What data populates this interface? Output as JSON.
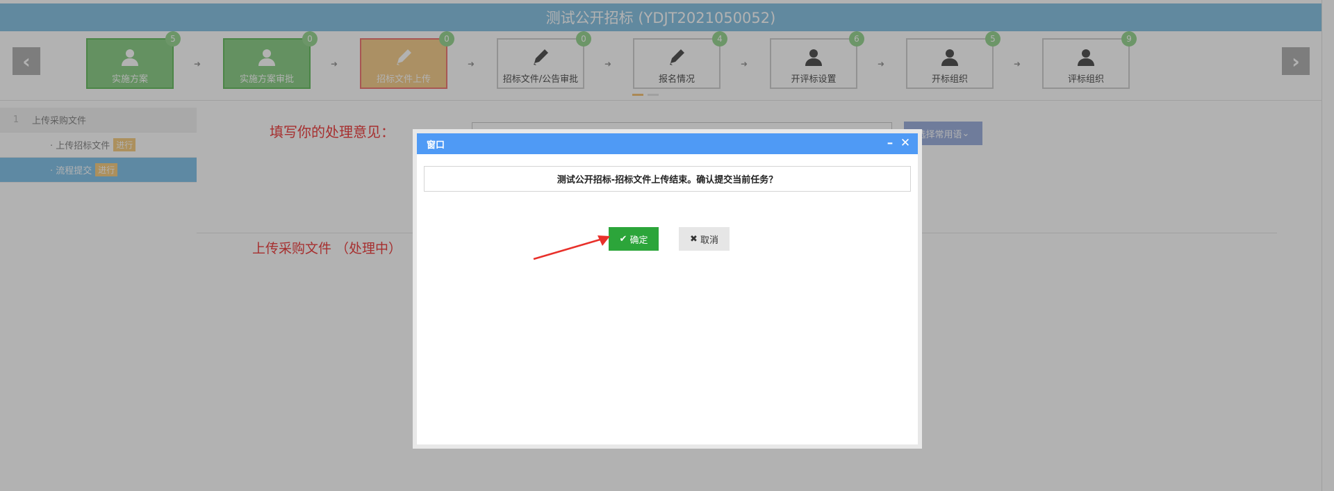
{
  "page": {
    "title": "测试公开招标 (YDJT2021050052)"
  },
  "steps": [
    {
      "label": "实施方案",
      "count": "5",
      "icon": "user-icon",
      "state": "done"
    },
    {
      "label": "实施方案审批",
      "count": "0",
      "icon": "user-icon",
      "state": "done"
    },
    {
      "label": "招标文件上传",
      "count": "0",
      "icon": "pencil-icon",
      "state": "current"
    },
    {
      "label": "招标文件/公告审批",
      "count": "0",
      "icon": "pencil-icon",
      "state": "todo"
    },
    {
      "label": "报名情况",
      "count": "4",
      "icon": "pencil-icon",
      "state": "todo"
    },
    {
      "label": "开评标设置",
      "count": "6",
      "icon": "user-icon",
      "state": "todo"
    },
    {
      "label": "开标组织",
      "count": "5",
      "icon": "user-icon",
      "state": "todo"
    },
    {
      "label": "评标组织",
      "count": "9",
      "icon": "user-icon",
      "state": "todo"
    }
  ],
  "sidebar": {
    "group_number": "1",
    "group_label": "上传采购文件",
    "items": [
      {
        "label": "· 上传招标文件",
        "tag": "进行"
      },
      {
        "label": "· 流程提交",
        "tag": "进行"
      }
    ]
  },
  "content": {
    "opinion_label": "填写你的处理意见：",
    "common_phrase_button": "选择常用语",
    "section_title": "上传采购文件 （处理中）"
  },
  "dialog": {
    "title": "窗口",
    "message": "测试公开招标-招标文件上传结束。确认提交当前任务？",
    "confirm_label": "确定",
    "cancel_label": "取消"
  },
  "colors": {
    "title_bar": "#8cc4e4",
    "done_step": "#90d08c",
    "current_step": "#f5cf90",
    "modal_header": "#4f9af5",
    "confirm_button": "#2ca53a",
    "annotation_arrow": "#e8302a"
  }
}
